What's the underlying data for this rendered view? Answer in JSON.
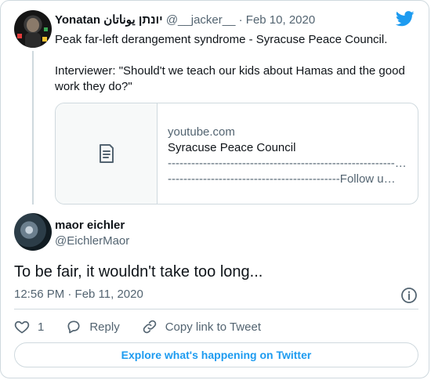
{
  "colors": {
    "accent": "#1d9bf0",
    "text": "#0f1419",
    "muted": "#536471",
    "border": "#cfd9de"
  },
  "parent_tweet": {
    "author_name": "Yonatan יונתן يوناتان",
    "handle": "@__jacker__",
    "separator": " · ",
    "date": "Feb 10, 2020",
    "text_lines": [
      "Peak far-left derangement syndrome - Syracuse Peace Council.",
      "Interviewer: \"Should't we teach our kids about Hamas and the good work they do?\""
    ],
    "link_card": {
      "icon": "document-icon",
      "domain": "youtube.com",
      "title": "Syracuse Peace Council",
      "desc_line1": "-------------------------------------------------------------------",
      "desc_line2": "--------------------------------------------Follow u…"
    }
  },
  "reply_tweet": {
    "author_name": "maor eichler",
    "handle": "@EichlerMaor",
    "text": "To be fair, it wouldn't take too long...",
    "timestamp": "12:56 PM · Feb 11, 2020"
  },
  "actions": {
    "like_count": "1",
    "reply_label": "Reply",
    "copy_link_label": "Copy link to Tweet"
  },
  "explore_button": "Explore what's happening on Twitter"
}
